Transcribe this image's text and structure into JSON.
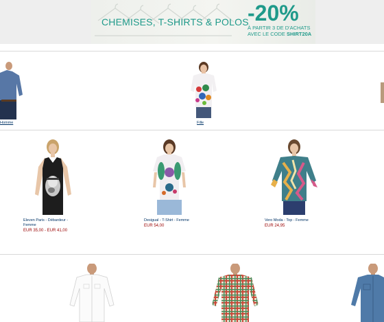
{
  "banner": {
    "title": "CHEMISES, T-SHIRTS & POLOS",
    "discount": "-20%",
    "condition": "À PARTIR 3 DE D'ACHATS",
    "code_prefix": "AVEC LE CODE ",
    "code": "SHIRT20A"
  },
  "row1": [
    {
      "caption": "Homme"
    },
    {
      "caption": "Fille"
    }
  ],
  "row2": [
    {
      "name": "Eleven Paris - Débardeur - Femme",
      "price": "EUR 35,00 - EUR 41,00"
    },
    {
      "name": "Desigual - T-Shirt - Femme",
      "price": "EUR 54,00"
    },
    {
      "name": "Vero Moda - Top - Femme",
      "price": "EUR 24,95"
    }
  ],
  "colors": {
    "accent": "#1f9a8a",
    "link": "#003366",
    "price": "#990000"
  }
}
